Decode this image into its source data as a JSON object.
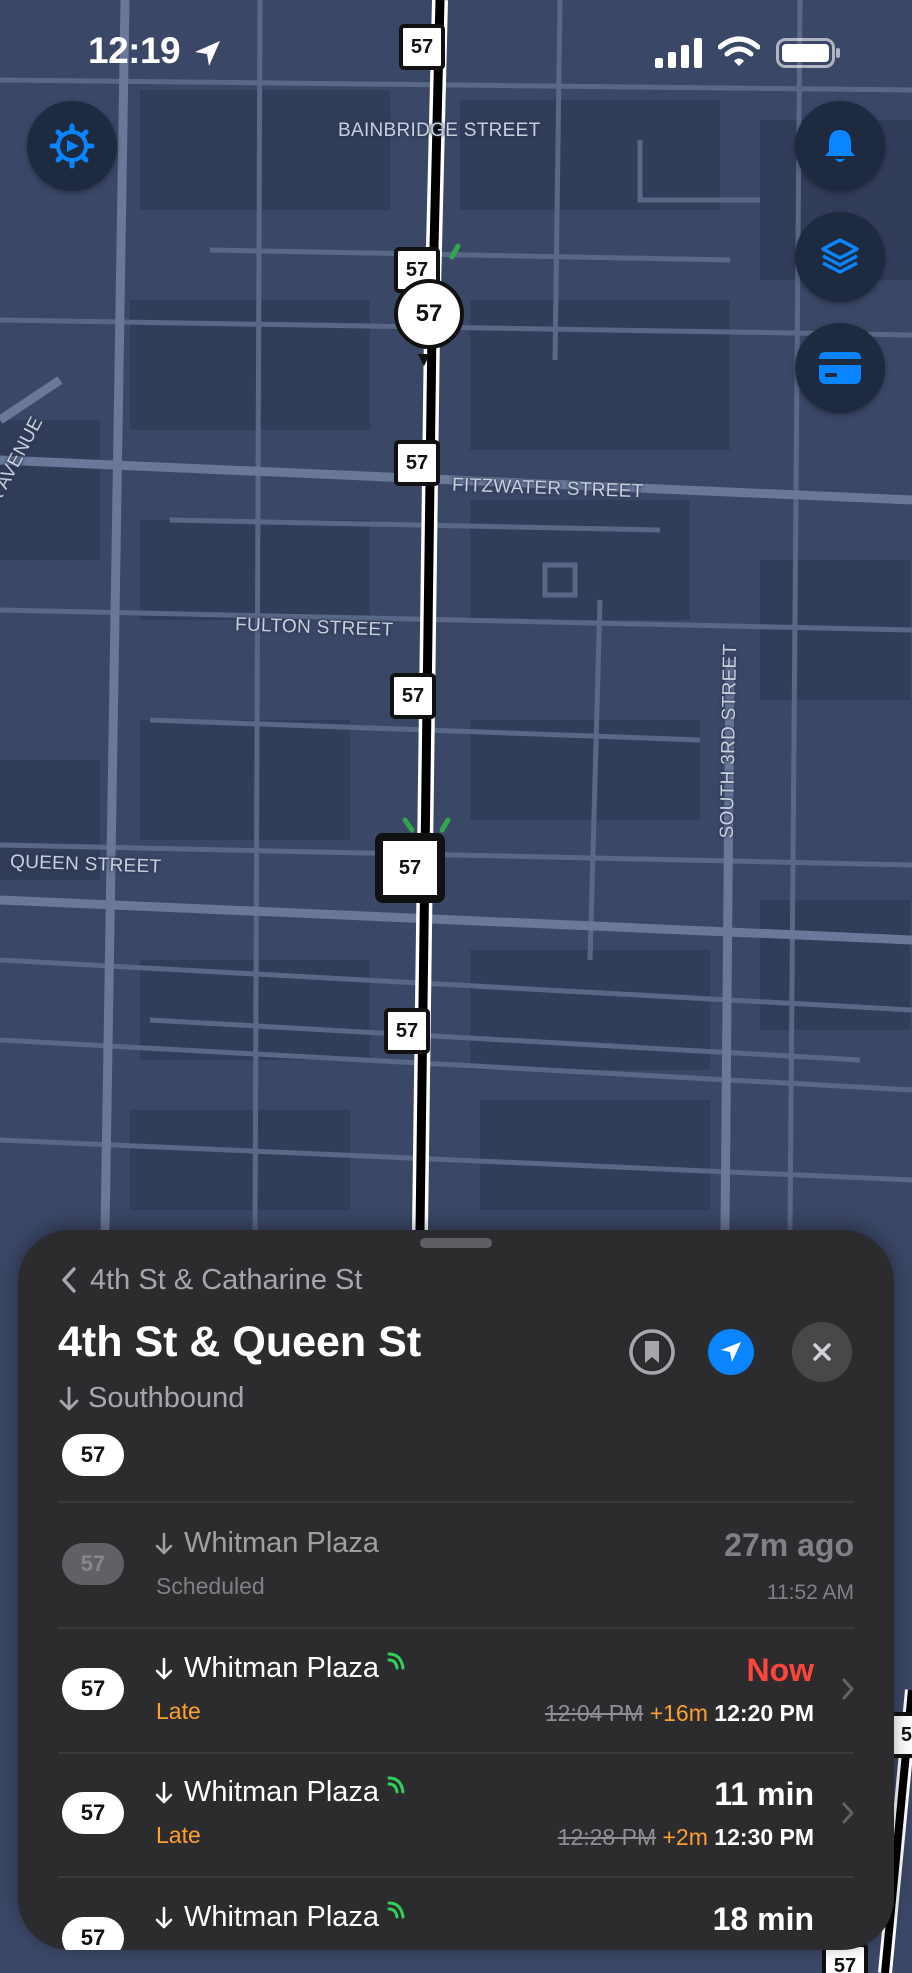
{
  "status_bar": {
    "time": "12:19"
  },
  "map": {
    "streets": {
      "bainbridge": "BAINBRIDGE STREET",
      "fitzwater": "FITZWATER STREET",
      "fulton": "FULTON STREET",
      "queen": "QUEEN STREET",
      "south3rd": "SOUTH 3RD STREET",
      "avenue": "K AVENUE"
    },
    "route_label": "57",
    "colors": {
      "map_bg": "#3b4766",
      "route_line": "#000000",
      "accent": "#0a84ff"
    }
  },
  "buttons": {
    "settings_icon": "gear-icon",
    "notifications_icon": "bell-icon",
    "layers_icon": "layers-icon",
    "fare_icon": "credit-card-icon"
  },
  "sheet": {
    "back_label": "4th St & Catharine St",
    "title": "4th St & Queen St",
    "direction": "Southbound",
    "route": "57",
    "arrivals": [
      {
        "route": "57",
        "destination": "Whitman Plaza",
        "status": "Scheduled",
        "eta": "27m ago",
        "time": "11:52 AM"
      },
      {
        "route": "57",
        "destination": "Whitman Plaza",
        "status": "Late",
        "eta": "Now",
        "scheduled": "12:04 PM",
        "delay": "+16m",
        "time": "12:20 PM"
      },
      {
        "route": "57",
        "destination": "Whitman Plaza",
        "status": "Late",
        "eta": "11 min",
        "scheduled": "12:28 PM",
        "delay": "+2m",
        "time": "12:30 PM"
      },
      {
        "route": "57",
        "destination": "Whitman Plaza",
        "eta": "18 min"
      }
    ]
  }
}
